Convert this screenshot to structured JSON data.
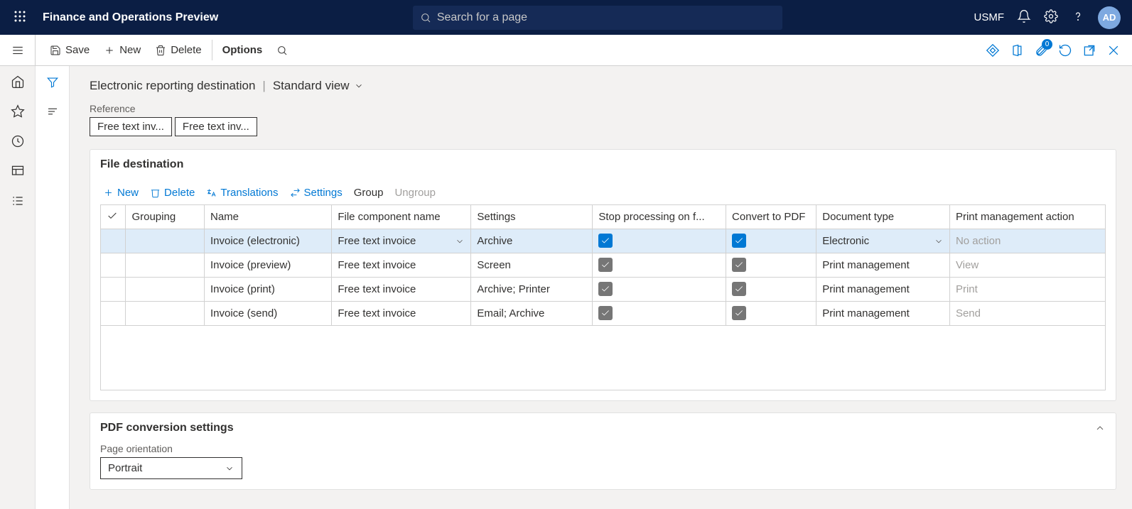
{
  "header": {
    "app_title": "Finance and Operations Preview",
    "search_placeholder": "Search for a page",
    "entity": "USMF",
    "avatar": "AD"
  },
  "actions": {
    "save": "Save",
    "new": "New",
    "delete": "Delete",
    "options": "Options",
    "attach_badge": "0"
  },
  "breadcrumb": {
    "title": "Electronic reporting destination",
    "view": "Standard view"
  },
  "reference": {
    "label": "Reference",
    "chips": [
      "Free text inv...",
      "Free text inv..."
    ]
  },
  "file_dest": {
    "title": "File destination",
    "toolbar": {
      "new": "New",
      "delete": "Delete",
      "translations": "Translations",
      "settings": "Settings",
      "group": "Group",
      "ungroup": "Ungroup"
    },
    "columns": {
      "grouping": "Grouping",
      "name": "Name",
      "file_component": "File component name",
      "settings": "Settings",
      "stop": "Stop processing on f...",
      "convert": "Convert to PDF",
      "doc_type": "Document type",
      "pm_action": "Print management action"
    },
    "rows": [
      {
        "name": "Invoice (electronic)",
        "file": "Free text invoice",
        "settings": "Archive",
        "stop": true,
        "stopStyle": "blue",
        "convert": true,
        "convertStyle": "blue",
        "doc": "Electronic",
        "action": "No action",
        "actionDisabled": true,
        "selected": true
      },
      {
        "name": "Invoice (preview)",
        "file": "Free text invoice",
        "settings": "Screen",
        "stop": true,
        "stopStyle": "gray",
        "convert": true,
        "convertStyle": "gray",
        "doc": "Print management",
        "action": "View",
        "actionDisabled": true
      },
      {
        "name": "Invoice (print)",
        "file": "Free text invoice",
        "settings": "Archive; Printer",
        "stop": true,
        "stopStyle": "gray",
        "convert": true,
        "convertStyle": "gray",
        "doc": "Print management",
        "action": "Print",
        "actionDisabled": true
      },
      {
        "name": "Invoice (send)",
        "file": "Free text invoice",
        "settings": "Email; Archive",
        "stop": true,
        "stopStyle": "gray",
        "convert": true,
        "convertStyle": "gray",
        "doc": "Print management",
        "action": "Send",
        "actionDisabled": true
      }
    ]
  },
  "pdf": {
    "title": "PDF conversion settings",
    "orientation_label": "Page orientation",
    "orientation_value": "Portrait"
  }
}
